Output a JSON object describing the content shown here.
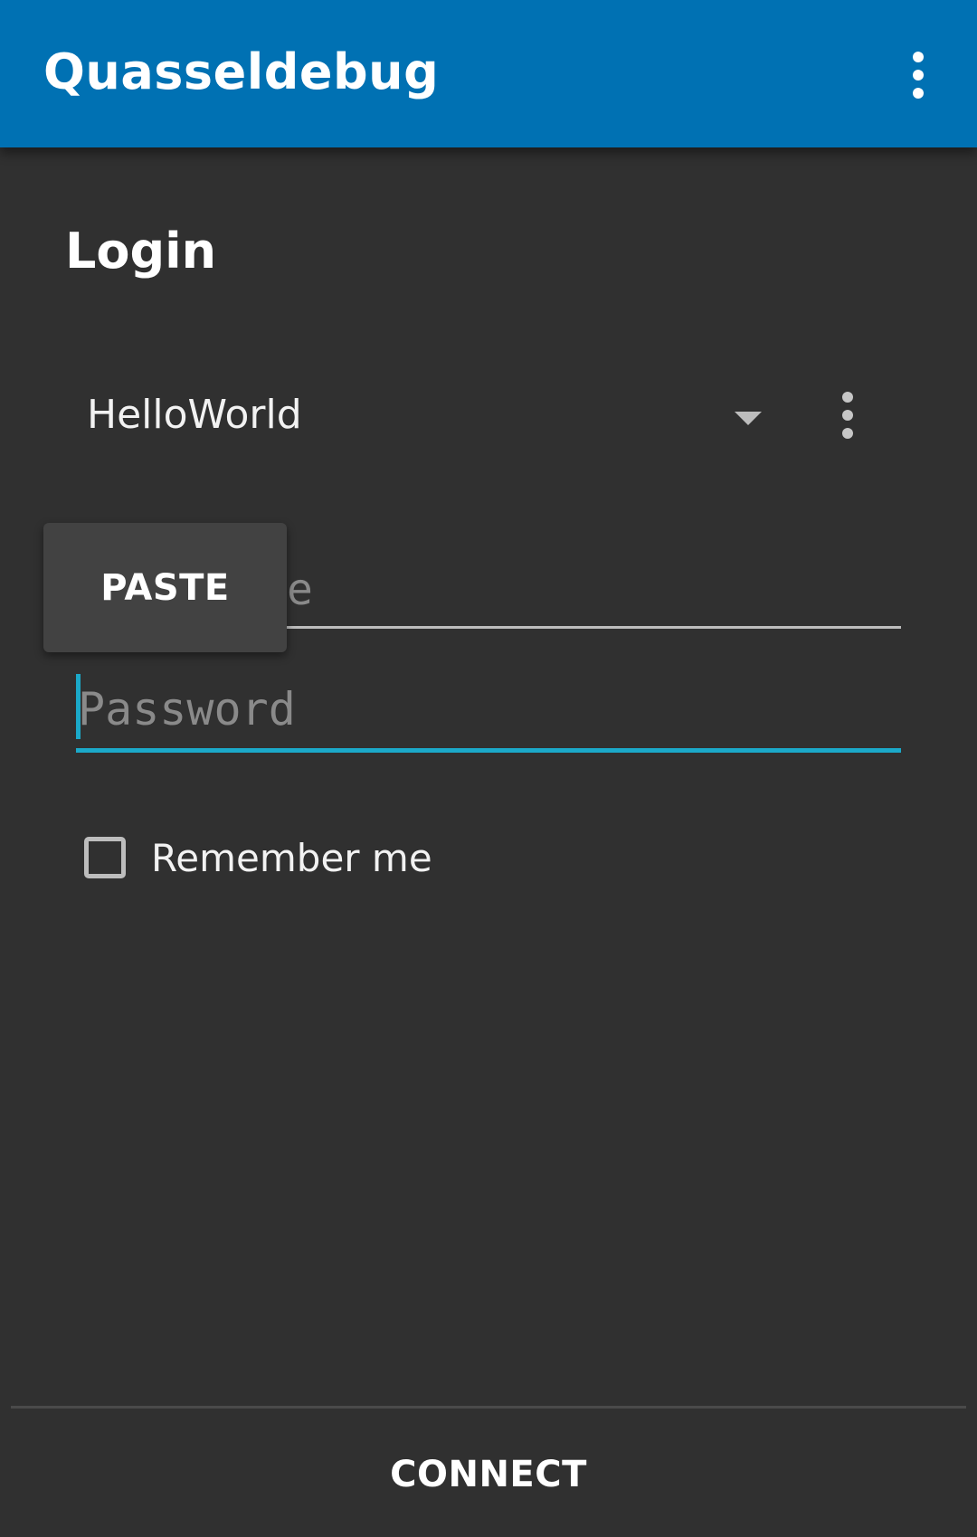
{
  "appbar": {
    "title": "Quasseldebug",
    "overflow_icon": "more-vert-icon",
    "background": "#0071b3"
  },
  "login": {
    "title": "Login",
    "account": {
      "selected": "HelloWorld",
      "dropdown_icon": "dropdown-arrow-icon",
      "menu_icon": "more-vert-icon"
    },
    "username": {
      "placeholder_visible_fragment": "e"
    },
    "password": {
      "placeholder": "Password",
      "accent": "#1ba9c9"
    },
    "remember_me": {
      "label": "Remember me",
      "checked": false
    }
  },
  "context_popup": {
    "paste_label": "PASTE"
  },
  "footer": {
    "connect_label": "CONNECT"
  }
}
